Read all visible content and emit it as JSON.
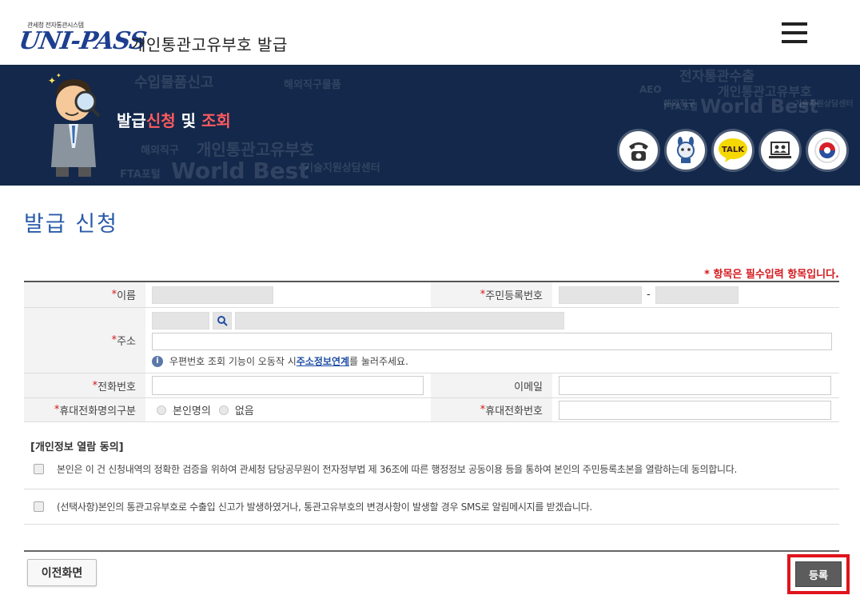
{
  "header": {
    "small_text": "관세청 전자통관시스템",
    "logo_text": "UNI-PASS",
    "title": "개인통관고유부호 발급"
  },
  "banner": {
    "title_part1": "발급",
    "title_part2": "신청",
    "title_part3": " 및 ",
    "title_part4": "조회",
    "bg_words": [
      "수입물품신고",
      "해외직구물품",
      "전자통관수출",
      "개인통관고유부호",
      "AEO",
      "해외직구",
      "FTA포털",
      "World Best",
      "기술지원상담센터",
      "개인통관고유부호",
      "해외직구",
      "FTA포털",
      "World Best",
      "기술지원상담센터"
    ],
    "talk_label": "TALK",
    "icons": [
      "phone-icon",
      "mascot-chat-icon",
      "kakao-talk-icon",
      "remote-support-icon",
      "government-emblem-icon"
    ]
  },
  "page": {
    "title": "발급 신청",
    "required_note": "* 항목은 필수입력 항목입니다."
  },
  "form": {
    "star": "*",
    "name_label": "이름",
    "rrn_label": "주민등록번호",
    "rrn_sep": "-",
    "address_label": "주소",
    "address_info": "우편번호 조회 기능이 오동작 시 ",
    "address_link": "주소정보연계",
    "address_info_end": "를 눌러주세요.",
    "phone_label": "전화번호",
    "email_label": "이메일",
    "mobile_type_label": "휴대전화명의구분",
    "mobile_type_options": [
      "본인명의",
      "없음"
    ],
    "mobile_label": "휴대전화번호"
  },
  "consent": {
    "title": "[개인정보 열람 동의]",
    "item1": "본인은 이 건 신청내역의 정확한 검증을 위하여 관세청 담당공무원이 전자정부법 제 36조에 따른 행정정보 공동이용 등을 통하여 본인의 주민등록초본을 열람하는데 동의합니다.",
    "item2": "(선택사항)본인의 통관고유부호로 수출입 신고가 발생하였거나, 통관고유부호의 변경사항이 발생할 경우 SMS로 알림메시지를 받겠습니다."
  },
  "buttons": {
    "prev": "이전화면",
    "submit": "등록"
  },
  "colors": {
    "brand_blue": "#2a5ba8",
    "banner_bg": "#13284a",
    "required_red": "#d4171d",
    "highlight_box": "#e0141c"
  }
}
